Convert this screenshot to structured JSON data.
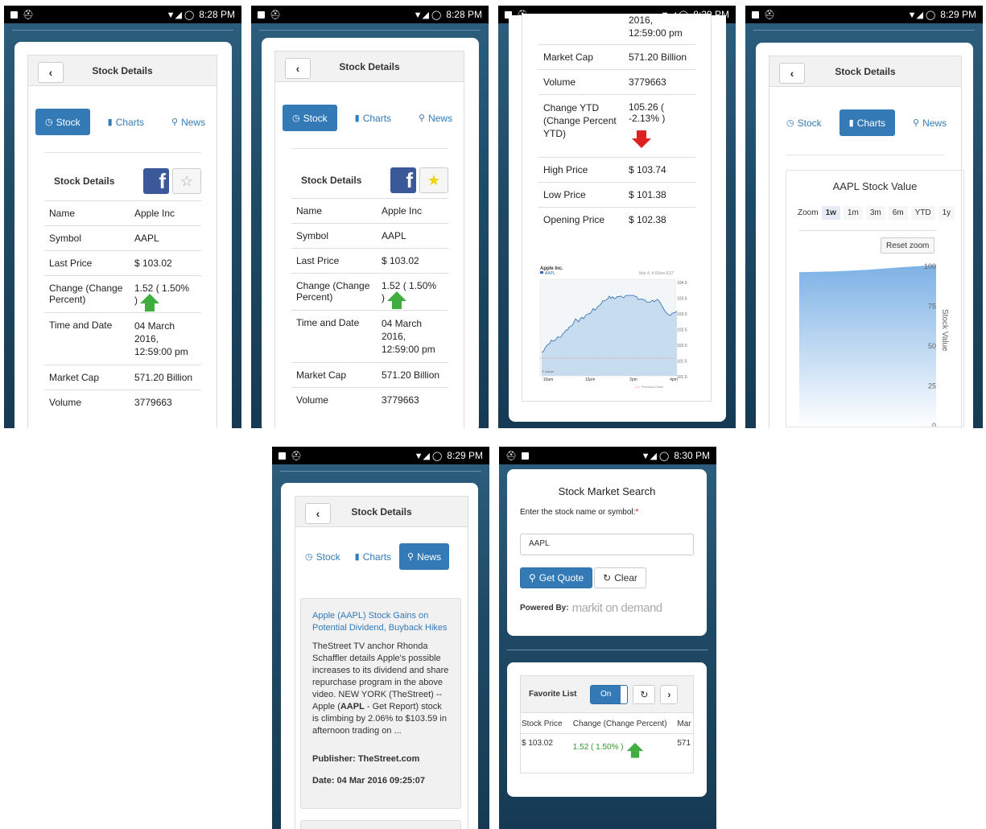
{
  "status": {
    "p1": "8:28 PM",
    "p2": "8:28 PM",
    "p3": "8:29 PM",
    "p4": "8:29 PM",
    "p5": "8:29 PM",
    "p6": "8:30 PM"
  },
  "header": {
    "title": "Stock Details",
    "back": "‹"
  },
  "tabs": {
    "stock": "Stock",
    "charts": "Charts",
    "news": "News"
  },
  "details": {
    "heading": "Stock Details",
    "rows": [
      {
        "k": "Name",
        "v": "Apple Inc"
      },
      {
        "k": "Symbol",
        "v": "AAPL"
      },
      {
        "k": "Last Price",
        "v": "$ 103.02"
      },
      {
        "k": "Change (Change Percent)",
        "v": "1.52 ( 1.50%"
      },
      {
        "k": "Time and Date",
        "v": "04 March 2016, 12:59:00 pm"
      },
      {
        "k": "Market Cap",
        "v": "571.20 Billion"
      },
      {
        "k": "Volume",
        "v": "3779663"
      }
    ],
    "change_close": ")"
  },
  "details2": {
    "date_tail": "2016,\n12:59:00 pm",
    "rows": [
      {
        "k": "Market Cap",
        "v": "571.20 Billion"
      },
      {
        "k": "Volume",
        "v": "3779663"
      },
      {
        "k": "Change YTD (Change Percent YTD)",
        "v": "105.26 ( -2.13% )"
      },
      {
        "k": "High Price",
        "v": "$ 103.74"
      },
      {
        "k": "Low Price",
        "v": "$ 101.38"
      },
      {
        "k": "Opening Price",
        "v": "$ 102.38"
      }
    ]
  },
  "minichart": {
    "title": "Apple Inc.",
    "legend": "AAPL",
    "date": "Mar 4, 4:00am EST",
    "source": "© Valuer",
    "prev": "Previous Close",
    "yticks": [
      "104.0",
      "103.5",
      "103.0",
      "102.5",
      "102.0",
      "101.5",
      "101.0"
    ],
    "xticks": [
      "10am",
      "12pm",
      "2pm",
      "4pm"
    ]
  },
  "chart": {
    "title": "AAPL Stock Value",
    "zoom": "Zoom",
    "zooms": [
      "1w",
      "1m",
      "3m",
      "6m",
      "YTD",
      "1y"
    ],
    "reset": "Reset zoom",
    "ylabel": "Stock Value",
    "yticks": [
      "100",
      "75",
      "50",
      "25",
      "0"
    ]
  },
  "news": {
    "title": "Apple (AAPL) Stock Gains on Potential Dividend, Buyback Hikes",
    "body1": "TheStreet TV anchor Rhonda Schaffler details Apple's possible increases to its dividend and share repurchase program in the above video. NEW YORK (TheStreet) -- Apple (",
    "bold": "AAPL",
    "body2": " - Get Report) stock is climbing by 2.06% to $103.59 in afternoon trading on ...",
    "publisher": "Publisher: TheStreet.com",
    "date": "Date: 04 Mar 2016 09:25:07"
  },
  "search": {
    "title": "Stock Market Search",
    "label": "Enter the stock name or symbol:",
    "required": "*",
    "value": "AAPL",
    "quote": "Get Quote",
    "clear": "Clear",
    "powered": "Powered By:",
    "brand": "markit on demand"
  },
  "favorites": {
    "title": "Favorite List",
    "toggle": "On",
    "cols": [
      "Stock Price",
      "Change (Change Percent)",
      "Mar"
    ],
    "price": "$ 103.02",
    "change": "1.52 ( 1.50% )",
    "cap": "571"
  }
}
